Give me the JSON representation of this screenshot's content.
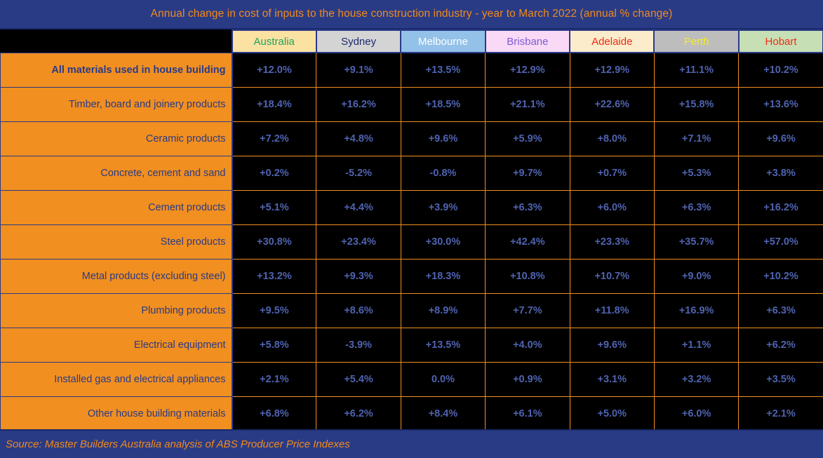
{
  "title": "Annual change in cost of inputs to the house construction industry - year to March 2022 (annual % change)",
  "source": "Source: Master Builders Australia analysis of ABS Producer Price Indexes",
  "colors": {
    "title_bar_bg": "#2a3b86",
    "title_text": "#f08a1c",
    "row_label_bg": "#f18f20",
    "row_label_text": "#2a3b86",
    "cell_bg": "#000000",
    "cell_text": "#4f63b0",
    "cell_border": "#f18f20",
    "source_bg": "#2a3b86",
    "source_text": "#f08a1c"
  },
  "chart_data": {
    "type": "table",
    "title": "Annual change in cost of inputs to the house construction industry - year to March 2022 (annual % change)",
    "xlabel": "",
    "ylabel": "",
    "categories": [
      "All materials used in house building",
      "Timber, board and joinery products",
      "Ceramic products",
      "Concrete, cement and sand",
      "Cement products",
      "Steel products",
      "Metal products (excluding steel)",
      "Plumbing products",
      "Electrical equipment",
      "Installed gas and electrical appliances",
      "Other house building materials"
    ],
    "series": [
      {
        "name": "Australia",
        "values": [
          12.0,
          18.4,
          7.2,
          0.2,
          5.1,
          30.8,
          13.2,
          9.5,
          5.8,
          2.1,
          6.8
        ]
      },
      {
        "name": "Sydney",
        "values": [
          9.1,
          16.2,
          4.8,
          -5.2,
          4.4,
          23.4,
          9.3,
          8.6,
          -3.9,
          5.4,
          6.2
        ]
      },
      {
        "name": "Melbourne",
        "values": [
          13.5,
          18.5,
          9.6,
          -0.8,
          3.9,
          30.0,
          18.3,
          8.9,
          13.5,
          0.0,
          8.4
        ]
      },
      {
        "name": "Brisbane",
        "values": [
          12.9,
          21.1,
          5.9,
          9.7,
          6.3,
          42.4,
          10.8,
          7.7,
          4.0,
          0.9,
          6.1
        ]
      },
      {
        "name": "Adelaide",
        "values": [
          12.9,
          22.6,
          8.0,
          0.7,
          6.0,
          23.3,
          10.7,
          11.8,
          9.6,
          3.1,
          5.0
        ]
      },
      {
        "name": "Perth",
        "values": [
          11.1,
          15.8,
          7.1,
          5.3,
          6.3,
          35.7,
          9.0,
          16.9,
          1.1,
          3.2,
          6.0
        ]
      },
      {
        "name": "Hobart",
        "values": [
          10.2,
          13.6,
          9.6,
          3.8,
          16.2,
          57.0,
          10.2,
          6.3,
          6.2,
          3.5,
          2.1
        ]
      }
    ],
    "units": "percent",
    "legend": "none",
    "grid": true
  },
  "table": {
    "columns": [
      {
        "label": "Australia",
        "bg": "#fbe2a3",
        "fg": "#1ea35a"
      },
      {
        "label": "Sydney",
        "bg": "#d4d4d4",
        "fg": "#1c2a6e"
      },
      {
        "label": "Melbourne",
        "bg": "#93c1e8",
        "fg": "#ffffff"
      },
      {
        "label": "Brisbane",
        "bg": "#f9d9f6",
        "fg": "#7b5cd6"
      },
      {
        "label": "Adelaide",
        "bg": "#fbeccb",
        "fg": "#f22b18"
      },
      {
        "label": "Perth",
        "bg": "#bdbdbd",
        "fg": "#f6ed1b"
      },
      {
        "label": "Hobart",
        "bg": "#c6dfb4",
        "fg": "#f22b18"
      }
    ],
    "rows": [
      {
        "label": "All materials used in house building",
        "emphasis": true,
        "values": [
          "+12.0%",
          "+9.1%",
          "+13.5%",
          "+12.9%",
          "+12.9%",
          "+11.1%",
          "+10.2%"
        ]
      },
      {
        "label": "Timber, board and joinery products",
        "emphasis": false,
        "values": [
          "+18.4%",
          "+16.2%",
          "+18.5%",
          "+21.1%",
          "+22.6%",
          "+15.8%",
          "+13.6%"
        ]
      },
      {
        "label": "Ceramic products",
        "emphasis": false,
        "values": [
          "+7.2%",
          "+4.8%",
          "+9.6%",
          "+5.9%",
          "+8.0%",
          "+7.1%",
          "+9.6%"
        ]
      },
      {
        "label": "Concrete, cement and sand",
        "emphasis": false,
        "values": [
          "+0.2%",
          "-5.2%",
          "-0.8%",
          "+9.7%",
          "+0.7%",
          "+5.3%",
          "+3.8%"
        ]
      },
      {
        "label": "Cement products",
        "emphasis": false,
        "values": [
          "+5.1%",
          "+4.4%",
          "+3.9%",
          "+6.3%",
          "+6.0%",
          "+6.3%",
          "+16.2%"
        ]
      },
      {
        "label": "Steel products",
        "emphasis": false,
        "values": [
          "+30.8%",
          "+23.4%",
          "+30.0%",
          "+42.4%",
          "+23.3%",
          "+35.7%",
          "+57.0%"
        ]
      },
      {
        "label": "Metal products (excluding steel)",
        "emphasis": false,
        "values": [
          "+13.2%",
          "+9.3%",
          "+18.3%",
          "+10.8%",
          "+10.7%",
          "+9.0%",
          "+10.2%"
        ]
      },
      {
        "label": "Plumbing products",
        "emphasis": false,
        "values": [
          "+9.5%",
          "+8.6%",
          "+8.9%",
          "+7.7%",
          "+11.8%",
          "+16.9%",
          "+6.3%"
        ]
      },
      {
        "label": "Electrical equipment",
        "emphasis": false,
        "values": [
          "+5.8%",
          "-3.9%",
          "+13.5%",
          "+4.0%",
          "+9.6%",
          "+1.1%",
          "+6.2%"
        ]
      },
      {
        "label": "Installed gas and electrical appliances",
        "emphasis": false,
        "values": [
          "+2.1%",
          "+5.4%",
          "0.0%",
          "+0.9%",
          "+3.1%",
          "+3.2%",
          "+3.5%"
        ]
      },
      {
        "label": "Other house building materials",
        "emphasis": false,
        "values": [
          "+6.8%",
          "+6.2%",
          "+8.4%",
          "+6.1%",
          "+5.0%",
          "+6.0%",
          "+2.1%"
        ]
      }
    ]
  }
}
